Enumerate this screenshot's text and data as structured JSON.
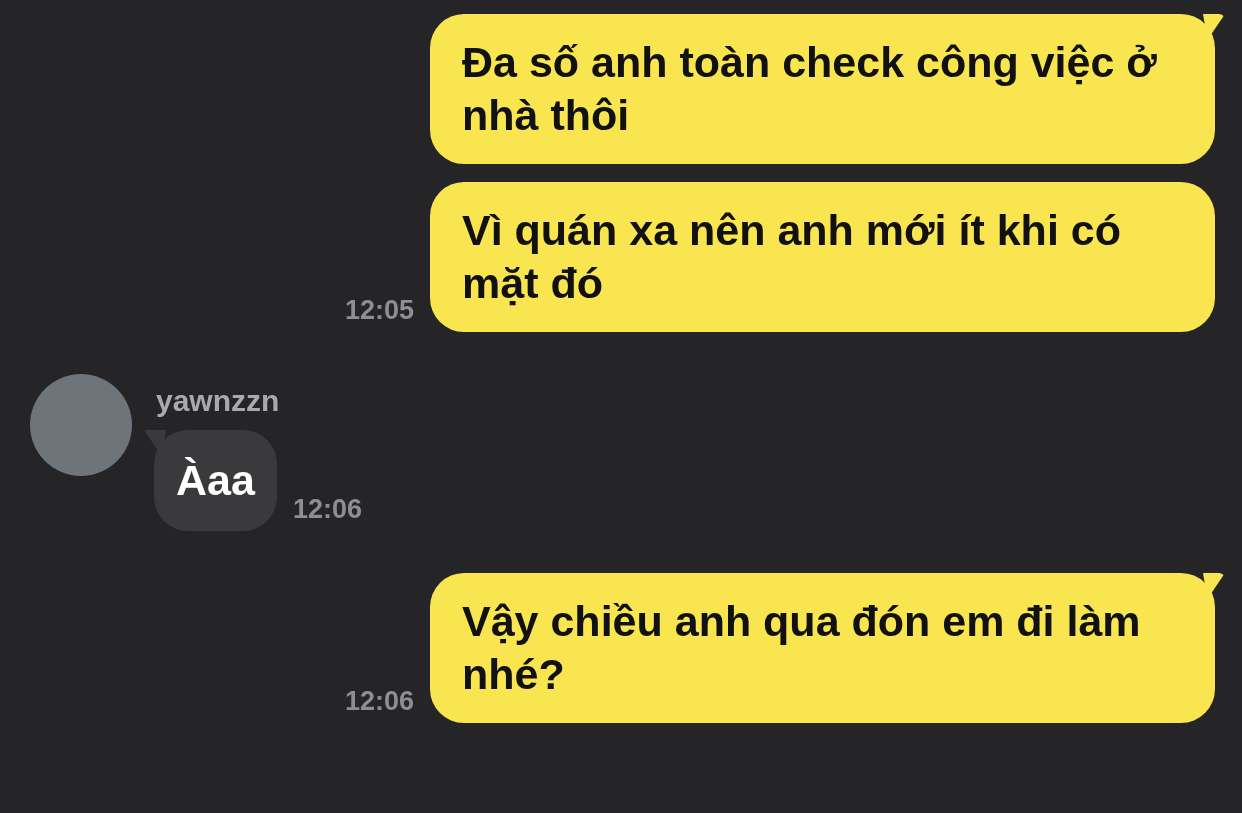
{
  "messages": [
    {
      "kind": "outgoing",
      "text": "Đa số anh toàn check công việc ở nhà thôi",
      "tail": true
    },
    {
      "kind": "outgoing",
      "text": "Vì quán xa nên anh mới ít khi có mặt đó",
      "time": "12:05",
      "tail": false
    },
    {
      "kind": "incoming",
      "sender": "yawnzzn",
      "text": "Àaa",
      "time": "12:06",
      "tail": true
    },
    {
      "kind": "outgoing",
      "text": "Vậy chiều anh qua đón em đi làm nhé?",
      "time": "12:06",
      "tail": true
    }
  ]
}
